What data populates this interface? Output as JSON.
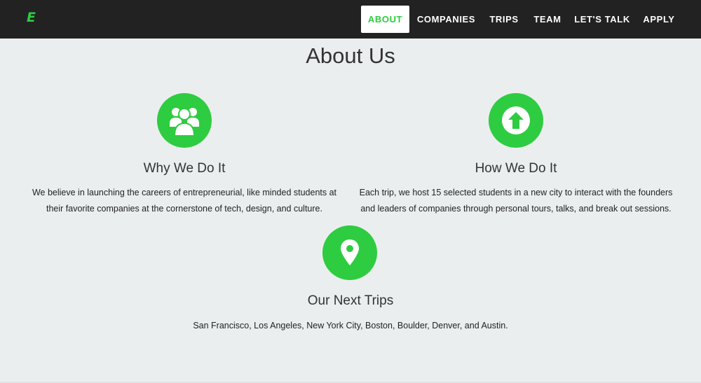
{
  "brand": {
    "logo_text": "E",
    "accent": "#2ecc40"
  },
  "nav": {
    "items": [
      {
        "label": "ABOUT",
        "active": true
      },
      {
        "label": "COMPANIES"
      },
      {
        "label": "TRIPS"
      },
      {
        "label": "TEAM"
      },
      {
        "label": "LET'S TALK"
      },
      {
        "label": "APPLY"
      }
    ]
  },
  "main": {
    "title": "About Us",
    "features": [
      {
        "icon": "users-icon",
        "heading": "Why We Do It",
        "lines": [
          "We believe in launching the careers of entrepreneurial, like minded students at",
          "their favorite companies at the cornerstone of tech, design, and culture."
        ]
      },
      {
        "icon": "arrow-up-circle-icon",
        "heading": "How We Do It",
        "lines": [
          "Each trip, we host 15 selected students in a new city to interact with the founders",
          "and leaders of companies through personal tours, talks, and break out sessions."
        ]
      },
      {
        "icon": "map-marker-icon",
        "heading": "Our Next Trips",
        "lines": [
          "San Francisco, Los Angeles, New York City, Boston, Boulder, Denver, and Austin."
        ]
      }
    ]
  }
}
